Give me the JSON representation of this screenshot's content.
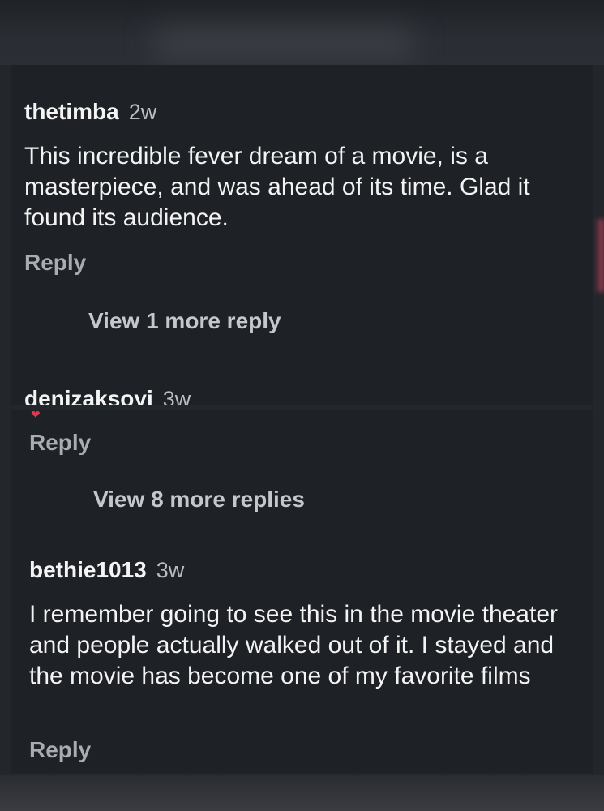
{
  "comments": [
    {
      "username": "thetimba",
      "time": "2w",
      "text": "This incredible fever dream of a movie, is a masterpiece, and was ahead of its time. Glad it found its audience.",
      "reply_label": "Reply",
      "more_replies_label": "View 1 more reply"
    },
    {
      "username": "denizaksoyi",
      "time": "3w",
      "reply_label": "Reply",
      "more_replies_label": "View 8 more replies"
    },
    {
      "username": "bethie1013",
      "time": "3w",
      "text": "I remember going to see this in the movie theater and people actually walked out of it. I stayed and the movie has become one of my favorite films",
      "reply_label": "Reply"
    }
  ],
  "colors": {
    "background": "#23262b",
    "panel": "#1e2126",
    "text": "#f3f3f3",
    "muted": "#a9acb3",
    "like_accent": "#e0384c"
  }
}
